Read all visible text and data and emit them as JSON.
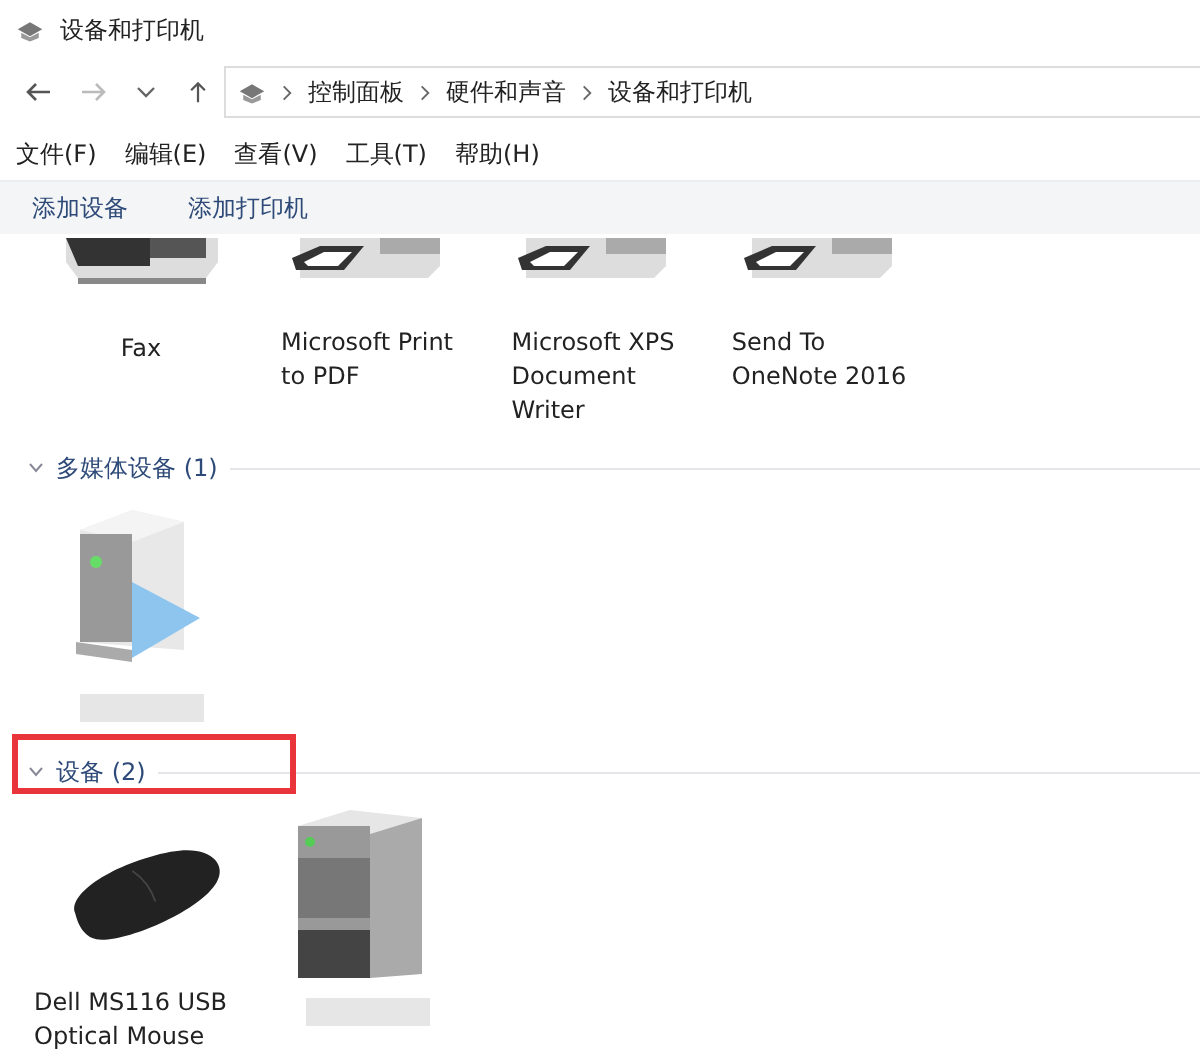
{
  "window": {
    "title": "设备和打印机"
  },
  "address_bar": {
    "path": [
      "控制面板",
      "硬件和声音",
      "设备和打印机"
    ]
  },
  "menu": [
    "文件(F)",
    "编辑(E)",
    "查看(V)",
    "工具(T)",
    "帮助(H)"
  ],
  "commands": [
    "添加设备",
    "添加打印机"
  ],
  "printers": [
    {
      "kind": "fax",
      "label": "Fax"
    },
    {
      "kind": "printer",
      "label": "Microsoft Print\nto PDF"
    },
    {
      "kind": "printer",
      "label": "Microsoft XPS\nDocument\nWriter"
    },
    {
      "kind": "printer",
      "label": "Send To\nOneNote 2016"
    }
  ],
  "sections": [
    {
      "title": "多媒体设备 (1)",
      "expanded": true,
      "highlighted": false,
      "items": [
        {
          "kind": "media-device"
        }
      ]
    },
    {
      "title": "设备 (2)",
      "expanded": true,
      "highlighted": true,
      "items": [
        {
          "kind": "mouse",
          "label": "Dell MS116 USB\nOptical Mouse"
        },
        {
          "kind": "computer"
        }
      ]
    }
  ]
}
